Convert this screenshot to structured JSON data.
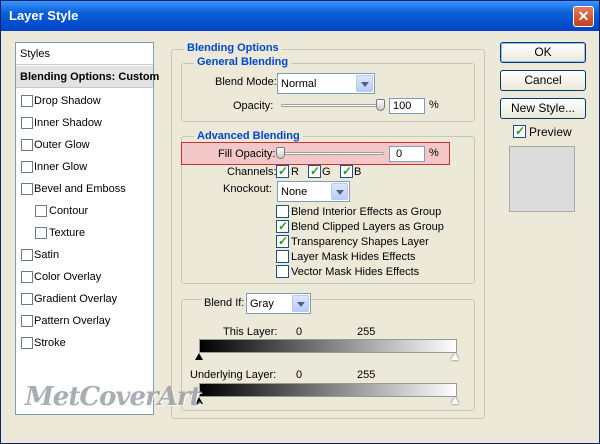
{
  "window": {
    "title": "Layer Style",
    "close_glyph": "✕"
  },
  "styles_list": {
    "header": "Styles",
    "selected": "Blending Options: Custom",
    "items": [
      {
        "label": "Drop Shadow",
        "checked": false,
        "sub": false
      },
      {
        "label": "Inner Shadow",
        "checked": false,
        "sub": false
      },
      {
        "label": "Outer Glow",
        "checked": false,
        "sub": false
      },
      {
        "label": "Inner Glow",
        "checked": false,
        "sub": false
      },
      {
        "label": "Bevel and Emboss",
        "checked": false,
        "sub": false
      },
      {
        "label": "Contour",
        "checked": false,
        "sub": true
      },
      {
        "label": "Texture",
        "checked": false,
        "sub": true
      },
      {
        "label": "Satin",
        "checked": false,
        "sub": false
      },
      {
        "label": "Color Overlay",
        "checked": false,
        "sub": false
      },
      {
        "label": "Gradient Overlay",
        "checked": false,
        "sub": false
      },
      {
        "label": "Pattern Overlay",
        "checked": false,
        "sub": false
      },
      {
        "label": "Stroke",
        "checked": false,
        "sub": false
      }
    ]
  },
  "blending_options": {
    "title": "Blending Options",
    "general": {
      "title": "General Blending",
      "blend_mode_label": "Blend Mode:",
      "blend_mode_value": "Normal",
      "opacity_label": "Opacity:",
      "opacity_value": "100",
      "opacity_unit": "%",
      "opacity_level": 1.0
    },
    "advanced": {
      "title": "Advanced Blending",
      "fill_opacity_label": "Fill Opacity:",
      "fill_opacity_value": "0",
      "fill_opacity_unit": "%",
      "fill_opacity_level": 0.0,
      "channels_label": "Channels:",
      "channels": [
        {
          "label": "R",
          "checked": true
        },
        {
          "label": "G",
          "checked": true
        },
        {
          "label": "B",
          "checked": true
        }
      ],
      "knockout_label": "Knockout:",
      "knockout_value": "None",
      "options": [
        {
          "label": "Blend Interior Effects as Group",
          "checked": false
        },
        {
          "label": "Blend Clipped Layers as Group",
          "checked": true
        },
        {
          "label": "Transparency Shapes Layer",
          "checked": true
        },
        {
          "label": "Layer Mask Hides Effects",
          "checked": false
        },
        {
          "label": "Vector Mask Hides Effects",
          "checked": false
        }
      ]
    },
    "blend_if": {
      "label": "Blend If:",
      "value": "Gray",
      "this_layer_label": "This Layer:",
      "this_layer_min": "0",
      "this_layer_max": "255",
      "underlying_label": "Underlying Layer:",
      "underlying_min": "0",
      "underlying_max": "255"
    }
  },
  "buttons": {
    "ok": "OK",
    "cancel": "Cancel",
    "new_style": "New Style...",
    "preview_label": "Preview",
    "preview_checked": true
  },
  "watermark": "MetCoverArt",
  "colors": {
    "title_bar": "#0a5fd6",
    "section_title": "#0046d5",
    "highlight_fill": "#f3c7c7",
    "highlight_border": "#cc3030",
    "check": "#21a121"
  }
}
